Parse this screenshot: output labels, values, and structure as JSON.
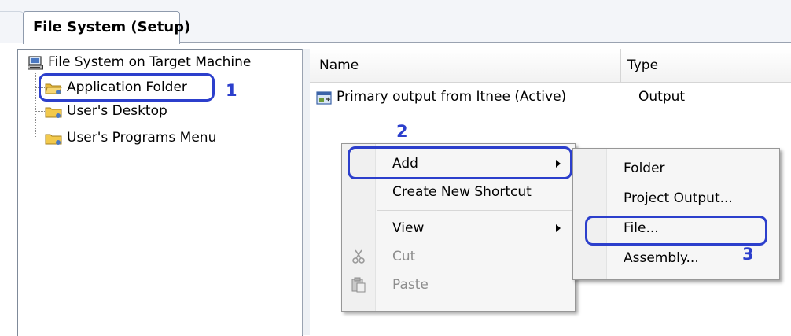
{
  "tab": {
    "label": "File System (Setup)"
  },
  "tree": {
    "root": "File System on Target Machine",
    "items": [
      "Application Folder",
      "User's Desktop",
      "User's Programs Menu"
    ]
  },
  "list": {
    "columns": [
      "Name",
      "Type"
    ],
    "rows": [
      {
        "name": "Primary output from Itnee (Active)",
        "type": "Output"
      }
    ]
  },
  "context_menu": {
    "items": [
      "Add",
      "Create New Shortcut",
      "View",
      "Cut",
      "Paste"
    ]
  },
  "submenu": {
    "items": [
      "Folder",
      "Project Output...",
      "File...",
      "Assembly..."
    ]
  },
  "annotations": [
    "1",
    "2",
    "3"
  ],
  "colors": {
    "annotation": "#2c3fcc",
    "folder": "#f2c94c"
  }
}
